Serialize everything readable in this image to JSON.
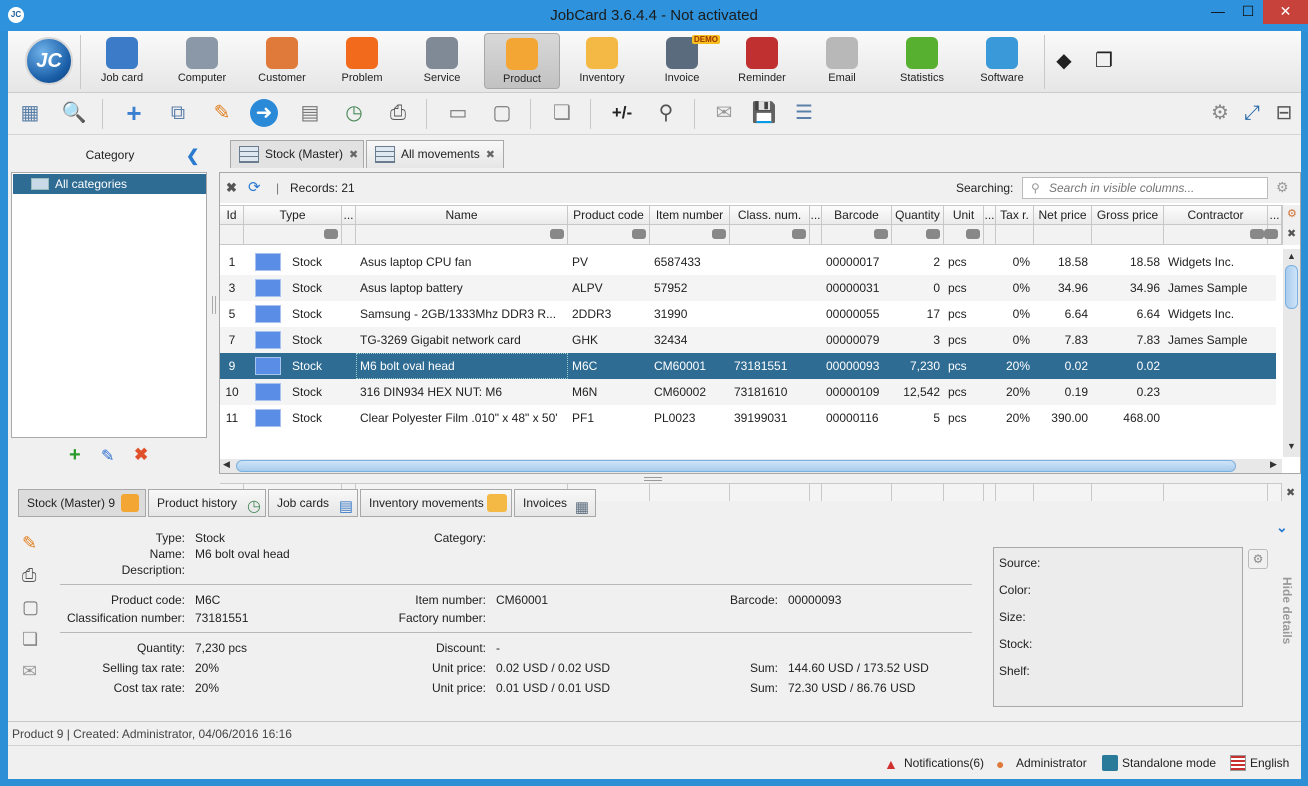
{
  "window": {
    "title": "JobCard 3.6.4.4 - Not activated",
    "app_icon": "JC",
    "minimize": "—",
    "maximize": "☐",
    "close": "✕"
  },
  "logo": {
    "text": "JC"
  },
  "main_toolbar": [
    {
      "label": "Job card",
      "icon": "job-card-icon",
      "color": "#3b7bc8"
    },
    {
      "label": "Computer",
      "icon": "gear-icon",
      "color": "#8b98a8"
    },
    {
      "label": "Customer",
      "icon": "customer-icon",
      "color": "#e07a3a"
    },
    {
      "label": "Problem",
      "icon": "problem-icon",
      "color": "#f26b1d"
    },
    {
      "label": "Service",
      "icon": "tools-icon",
      "color": "#7f8a96"
    },
    {
      "label": "Product",
      "icon": "box-icon",
      "color": "#f3a634"
    },
    {
      "label": "Inventory",
      "icon": "boxes-icon",
      "color": "#f4b944"
    },
    {
      "label": "Invoice",
      "icon": "invoice-icon",
      "color": "#5a6b7d",
      "badge": "DEMO"
    },
    {
      "label": "Reminder",
      "icon": "clock-icon",
      "color": "#c03030"
    },
    {
      "label": "Email",
      "icon": "email-icon",
      "color": "#b8b8b8"
    },
    {
      "label": "Statistics",
      "icon": "pie-chart-icon",
      "color": "#58b030"
    },
    {
      "label": "Software",
      "icon": "software-icon",
      "color": "#3a9ad9"
    }
  ],
  "categories": {
    "title": "Category",
    "collapse": "❮",
    "items": [
      "All categories"
    ]
  },
  "tabs": [
    {
      "label": "Stock (Master)",
      "close": "✖"
    },
    {
      "label": "All movements",
      "close": "✖"
    }
  ],
  "grid": {
    "records_sep": "|",
    "records": "Records: 21",
    "search_label": "Searching:",
    "search_placeholder": "Search in visible columns...",
    "columns": [
      "Id",
      "Type",
      "...",
      "Name",
      "Product code",
      "Item number",
      "Class. num.",
      "...",
      "Barcode",
      "Quantity",
      "Unit",
      "...",
      "Tax r.",
      "Net price",
      "Gross price",
      "Contractor",
      "..."
    ],
    "rows": [
      {
        "id": "1",
        "type": "Stock",
        "name": "Asus laptop CPU fan",
        "code": "PV",
        "item": "6587433",
        "class": "",
        "barcode": "00000017",
        "qty": "2",
        "unit": "pcs",
        "tax": "0%",
        "net": "18.58",
        "gross": "18.58",
        "contractor": "Widgets Inc."
      },
      {
        "id": "3",
        "type": "Stock",
        "name": "Asus laptop battery",
        "code": "ALPV",
        "item": "57952",
        "class": "",
        "barcode": "00000031",
        "qty": "0",
        "unit": "pcs",
        "tax": "0%",
        "net": "34.96",
        "gross": "34.96",
        "contractor": "James Sample"
      },
      {
        "id": "5",
        "type": "Stock",
        "name": "Samsung - 2GB/1333Mhz DDR3 R...",
        "code": "2DDR3",
        "item": "31990",
        "class": "",
        "barcode": "00000055",
        "qty": "17",
        "unit": "pcs",
        "tax": "0%",
        "net": "6.64",
        "gross": "6.64",
        "contractor": "Widgets Inc."
      },
      {
        "id": "7",
        "type": "Stock",
        "name": "TG-3269 Gigabit network card",
        "code": "GHK",
        "item": "32434",
        "class": "",
        "barcode": "00000079",
        "qty": "3",
        "unit": "pcs",
        "tax": "0%",
        "net": "7.83",
        "gross": "7.83",
        "contractor": "James Sample"
      },
      {
        "id": "9",
        "type": "Stock",
        "name": "M6 bolt oval head",
        "code": "M6C",
        "item": "CM60001",
        "class": "73181551",
        "barcode": "00000093",
        "qty": "7,230",
        "unit": "pcs",
        "tax": "20%",
        "net": "0.02",
        "gross": "0.02",
        "contractor": ""
      },
      {
        "id": "10",
        "type": "Stock",
        "name": "316 DIN934 HEX NUT: M6",
        "code": "M6N",
        "item": "CM60002",
        "class": "73181610",
        "barcode": "00000109",
        "qty": "12,542",
        "unit": "pcs",
        "tax": "20%",
        "net": "0.19",
        "gross": "0.23",
        "contractor": ""
      },
      {
        "id": "11",
        "type": "Stock",
        "name": "Clear Polyester Film .010\" x 48\" x 50'",
        "code": "PF1",
        "item": "PL0023",
        "class": "39199031",
        "barcode": "00000116",
        "qty": "5",
        "unit": "pcs",
        "tax": "20%",
        "net": "390.00",
        "gross": "468.00",
        "contractor": ""
      }
    ],
    "selected_row": 4,
    "row_color": "#5a8ee6"
  },
  "detail_tabs": [
    "Stock (Master) 9",
    "Product history",
    "Job cards",
    "Inventory movements",
    "Invoices"
  ],
  "hide_details": "Hide details",
  "details": {
    "type_l": "Type:",
    "type": "Stock",
    "name_l": "Name:",
    "name": "M6 bolt oval head",
    "desc_l": "Description:",
    "category_l": "Category:",
    "code_l": "Product code:",
    "code": "M6C",
    "item_l": "Item number:",
    "item": "CM60001",
    "barcode_l": "Barcode:",
    "barcode": "00000093",
    "class_l": "Classification number:",
    "class": "73181551",
    "factory_l": "Factory number:",
    "qty_l": "Quantity:",
    "qty": "7,230 pcs",
    "discount_l": "Discount:",
    "discount": "-",
    "sell_tax_l": "Selling tax rate:",
    "sell_tax": "20%",
    "unit1_l": "Unit price:",
    "unit1": "0.02 USD / 0.02 USD",
    "sum1_l": "Sum:",
    "sum1": "144.60 USD / 173.52 USD",
    "cost_tax_l": "Cost tax rate:",
    "cost_tax": "20%",
    "unit2_l": "Unit price:",
    "unit2": "0.01 USD / 0.01 USD",
    "sum2_l": "Sum:",
    "sum2": "72.30 USD / 86.76 USD",
    "side": [
      "Source:",
      "Color:",
      "Size:",
      "Stock:",
      "Shelf:"
    ]
  },
  "status": "Product 9 | Created: Administrator, 04/06/2016 16:16",
  "bottom": {
    "notifications": "Notifications(6)",
    "user": "Administrator",
    "mode": "Standalone mode",
    "language": "English"
  }
}
